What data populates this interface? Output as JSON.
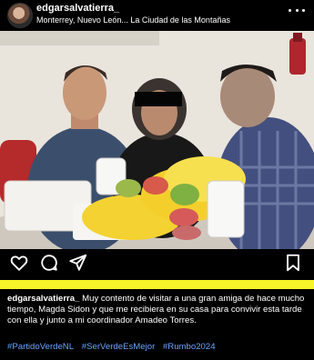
{
  "post": {
    "username": "edgarsalvatierra_",
    "location": "Monterrey, Nuevo León... La Ciudad de las Montañas",
    "more_icon": "more-horizontal-icon"
  },
  "actions": {
    "icons": [
      "heart-icon",
      "comment-icon",
      "share-icon",
      "bookmark-icon"
    ]
  },
  "caption": {
    "username": "edgarsalvatierra_",
    "text": "Muy contento de visitar a una gran amiga de hace mucho tiempo, Magda Sidon y que me recibiera en su casa para convivir esta tarde con ella y junto a mi coordinador Amadeo Torres."
  },
  "hashtags": [
    "#PartidoVerdeNL",
    "#SerVerdeEsMejor",
    "#Rumbo2024"
  ],
  "colors": {
    "background": "#000000",
    "highlight_bar": "#f7f42a",
    "hashtag": "#6aa4ff"
  }
}
